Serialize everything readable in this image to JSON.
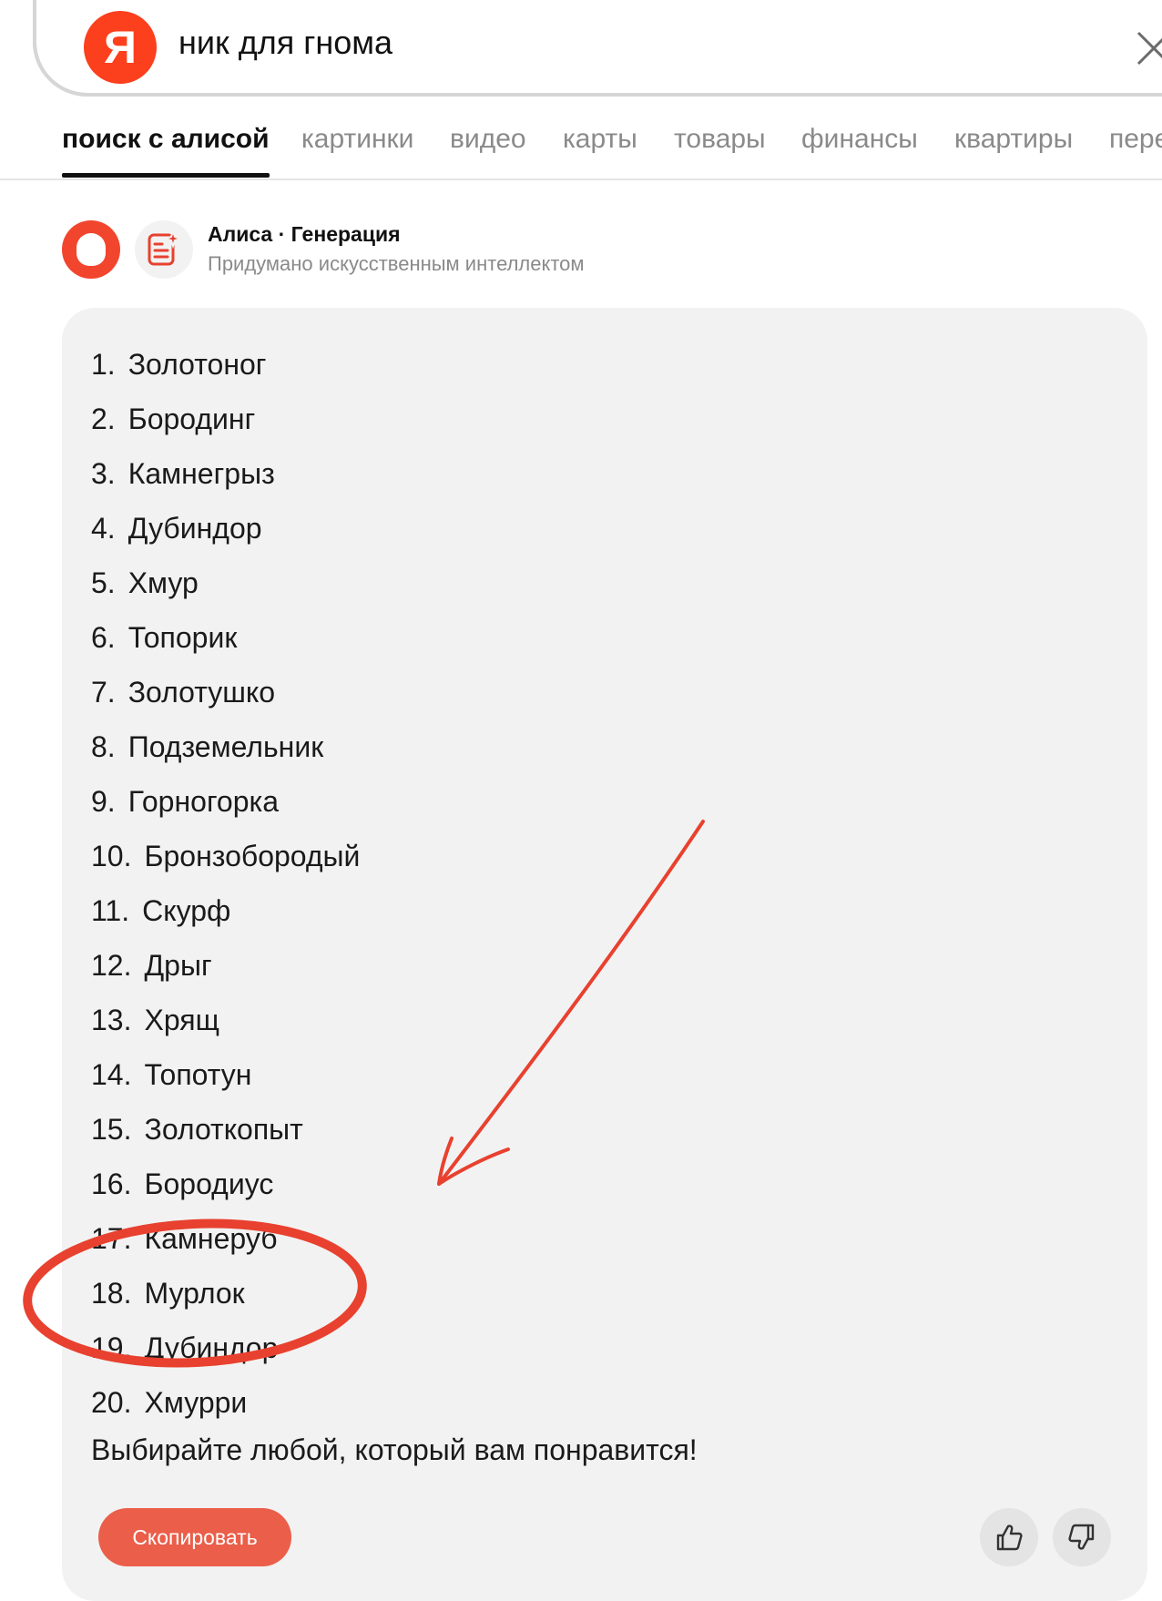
{
  "search": {
    "logo_letter": "Я",
    "query": "ник для гнома"
  },
  "tabs": [
    {
      "label": "поиск с алисой",
      "active": true
    },
    {
      "label": "картинки",
      "active": false
    },
    {
      "label": "видео",
      "active": false
    },
    {
      "label": "карты",
      "active": false
    },
    {
      "label": "товары",
      "active": false
    },
    {
      "label": "финансы",
      "active": false
    },
    {
      "label": "квартиры",
      "active": false
    },
    {
      "label": "пере",
      "active": false
    }
  ],
  "alice": {
    "title": "Алиса · Генерация",
    "subtitle": "Придумано искусственным интеллектом"
  },
  "answer": {
    "items": [
      {
        "num": "1.",
        "name": "Золотоног"
      },
      {
        "num": "2.",
        "name": "Бородинг"
      },
      {
        "num": "3.",
        "name": "Камнегрыз"
      },
      {
        "num": "4.",
        "name": "Дубиндор"
      },
      {
        "num": "5.",
        "name": "Хмур"
      },
      {
        "num": "6.",
        "name": "Топорик"
      },
      {
        "num": "7.",
        "name": "Золотушко"
      },
      {
        "num": "8.",
        "name": "Подземельник"
      },
      {
        "num": "9.",
        "name": "Горногорка"
      },
      {
        "num": "10.",
        "name": "Бронзобородый"
      },
      {
        "num": "11.",
        "name": "Скурф"
      },
      {
        "num": "12.",
        "name": "Дрыг"
      },
      {
        "num": "13.",
        "name": "Хрящ"
      },
      {
        "num": "14.",
        "name": "Топотун"
      },
      {
        "num": "15.",
        "name": "Золоткопыт"
      },
      {
        "num": "16.",
        "name": "Бородиус"
      },
      {
        "num": "17.",
        "name": "Камнеруб"
      },
      {
        "num": "18.",
        "name": "Мурлок"
      },
      {
        "num": "19.",
        "name": "Дубиндор"
      },
      {
        "num": "20.",
        "name": "Хмурри"
      }
    ],
    "closing": "Выбирайте любой, который вам понравится!",
    "copy_label": "Скопировать"
  },
  "colors": {
    "brand": "#fc3f1d",
    "annotation": "#e8412f",
    "card_bg": "#f2f2f2"
  },
  "icons": {
    "clear": "close-icon",
    "alice": "alice-icon",
    "generation": "generation-icon",
    "like": "thumb-up-icon",
    "dislike": "thumb-down-icon"
  }
}
